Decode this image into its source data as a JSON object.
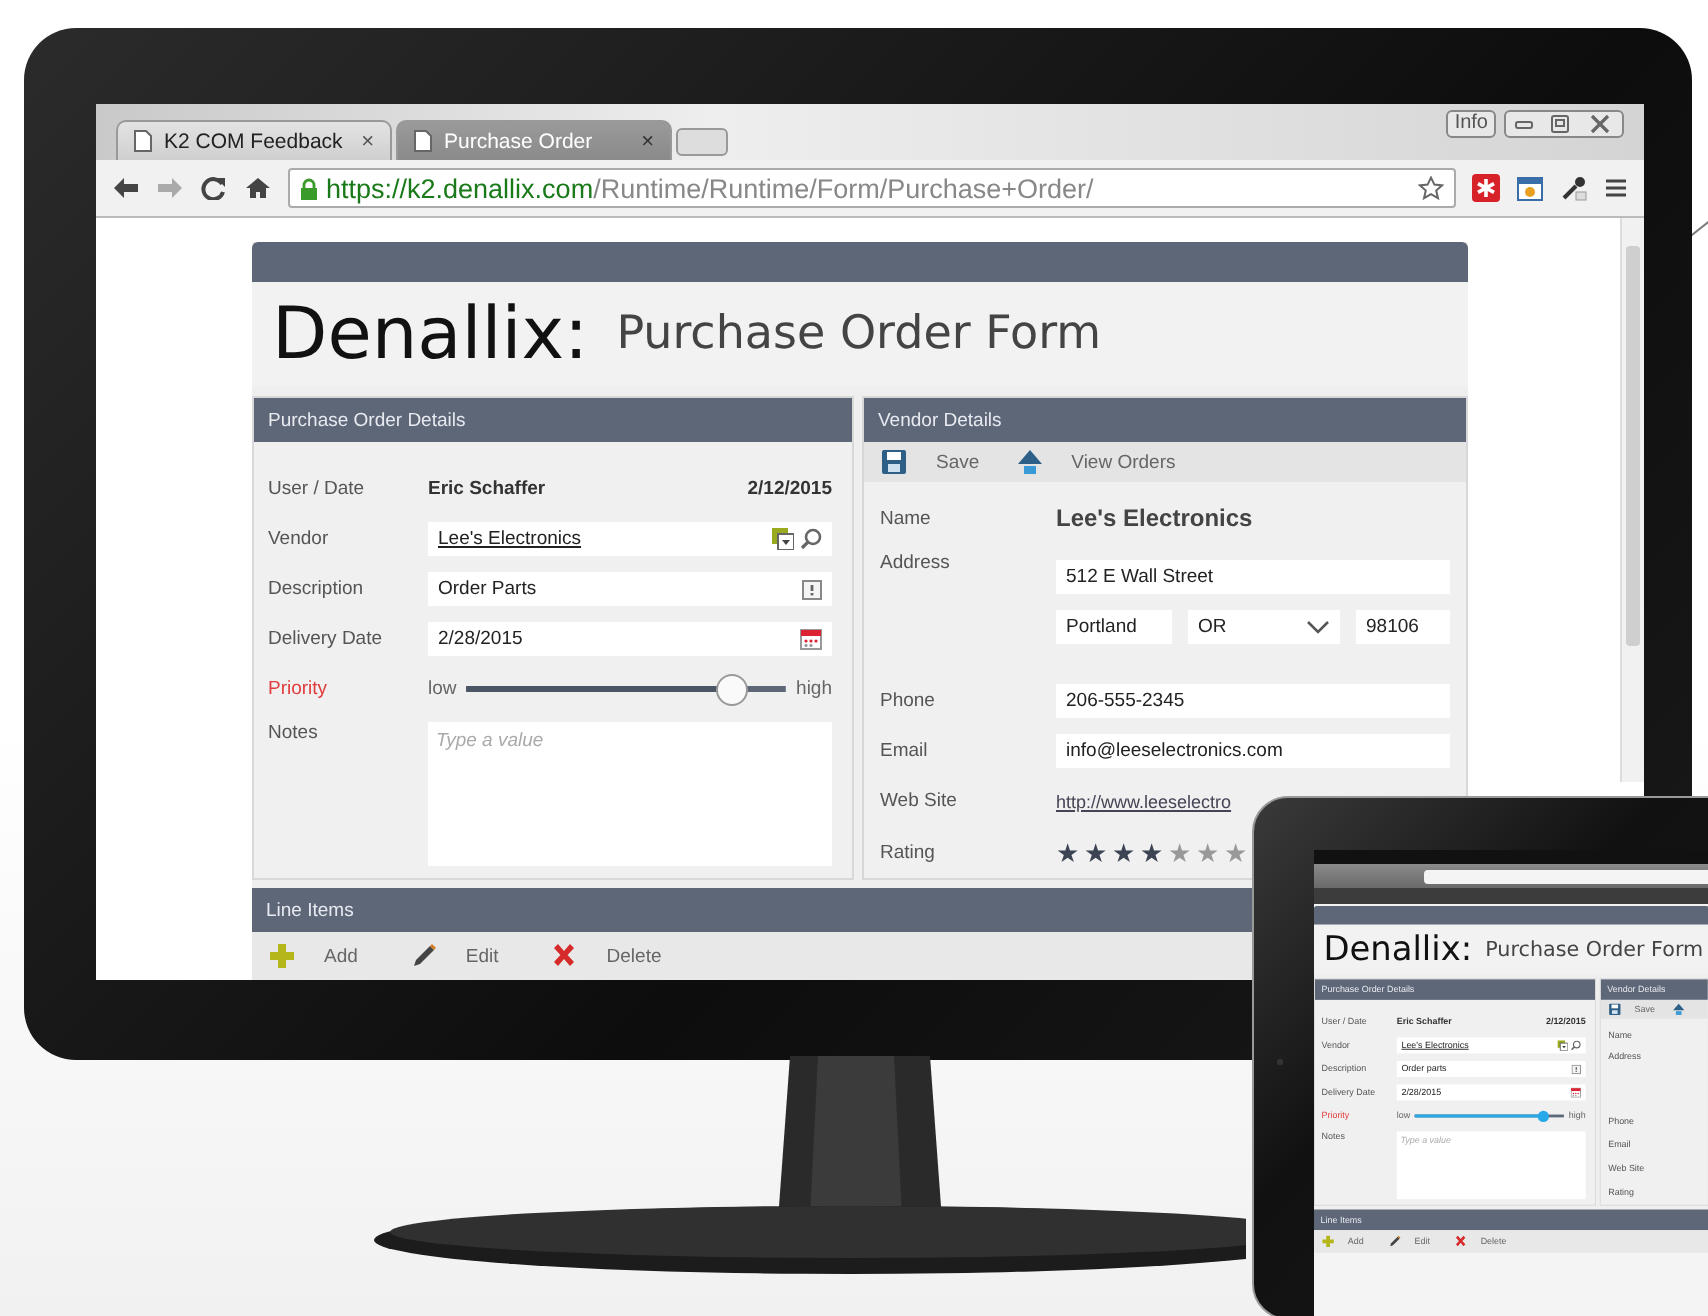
{
  "monitor": {
    "browser": {
      "tabs": [
        {
          "label": "K2 COM Feedback",
          "close": "×",
          "selected": false
        },
        {
          "label": "Purchase Order",
          "close": "×",
          "selected": true
        }
      ],
      "profile_button": "Info",
      "url": {
        "host": "https://k2.denallix.com",
        "path": "/Runtime/Runtime/Form/Purchase+Order/"
      }
    },
    "form": {
      "brand": "Denallix:",
      "title": "Purchase Order Form",
      "details": {
        "title": "Purchase Order Details",
        "user_label": "User / Date",
        "user": "Eric Schaffer",
        "date": "2/12/2015",
        "fields": [
          {
            "label": "Vendor",
            "value": "Lee's Electronics",
            "kind": "lookup"
          },
          {
            "label": "Description",
            "value": "Order Parts",
            "kind": "text"
          },
          {
            "label": "Delivery Date",
            "value": "2/28/2015",
            "kind": "date"
          }
        ],
        "priority": {
          "label": "Priority",
          "low": "low",
          "high": "high",
          "level": 0.83,
          "required": true,
          "kind": "plain"
        },
        "notes": {
          "label": "Notes",
          "placeholder": "Type a value"
        }
      },
      "vendor": {
        "title": "Vendor Details",
        "actions": [
          {
            "kind": "save",
            "label": "Save"
          },
          {
            "kind": "up",
            "label": "View Orders"
          }
        ],
        "name_label": "Name",
        "name": "Lee's Electronics",
        "address_label": "Address",
        "street": "512 E Wall Street",
        "city": "Portland",
        "state": "OR",
        "zip": "98106",
        "fields": [
          {
            "label": "Phone",
            "value": "206-555-2345",
            "kind": "field"
          },
          {
            "label": "Email",
            "value": "info@leeselectronics.com",
            "kind": "field"
          },
          {
            "label": "Web Site",
            "value": "http://www.leeselectro",
            "kind": "link"
          },
          {
            "label": "Rating",
            "kind": "rating",
            "stars": 4
          }
        ]
      },
      "line_items": {
        "title": "Line Items",
        "actions": [
          {
            "kind": "add",
            "label": "Add"
          },
          {
            "kind": "edit",
            "label": "Edit"
          },
          {
            "kind": "delete",
            "label": "Delete"
          }
        ]
      }
    }
  },
  "tablet": {
    "form": {
      "brand": "Denallix:",
      "title": "Purchase Order Form",
      "details": {
        "title": "Purchase Order Details",
        "user_label": "User / Date",
        "user": "Eric Schaffer",
        "date": "2/12/2015",
        "fields": [
          {
            "label": "Vendor",
            "value": "Lee's Electronics",
            "kind": "lookup"
          },
          {
            "label": "Description",
            "value": "Order parts",
            "kind": "text"
          },
          {
            "label": "Delivery Date",
            "value": "2/28/2015",
            "kind": "date"
          }
        ],
        "priority": {
          "label": "Priority",
          "low": "low",
          "high": "high",
          "level": 0.86,
          "required": true,
          "kind": "touch"
        },
        "notes": {
          "label": "Notes",
          "placeholder": "Type a value"
        }
      },
      "vendor": {
        "title": "Vendor Details",
        "actions": [
          {
            "kind": "save",
            "label": "Save"
          },
          {
            "kind": "up"
          }
        ],
        "name_label": "Name",
        "address_label": "Address",
        "fields": [
          {
            "label": "Phone"
          },
          {
            "label": "Email"
          },
          {
            "label": "Web Site"
          },
          {
            "label": "Rating"
          }
        ]
      },
      "line_items": {
        "title": "Line Items",
        "actions": [
          {
            "kind": "add",
            "label": "Add"
          },
          {
            "kind": "edit",
            "label": "Edit"
          },
          {
            "kind": "delete",
            "label": "Delete"
          }
        ]
      }
    }
  }
}
